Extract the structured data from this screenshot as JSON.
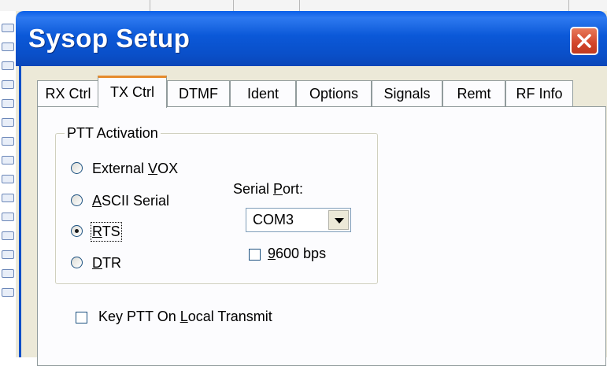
{
  "window": {
    "title": "Sysop Setup"
  },
  "tabs": [
    {
      "label": "RX Ctrl",
      "active": false
    },
    {
      "label": "TX Ctrl",
      "active": true
    },
    {
      "label": "DTMF",
      "active": false
    },
    {
      "label": "Ident",
      "active": false
    },
    {
      "label": "Options",
      "active": false
    },
    {
      "label": "Signals",
      "active": false
    },
    {
      "label": "Remt",
      "active": false
    },
    {
      "label": "RF Info",
      "active": false
    }
  ],
  "ptt": {
    "group_label": "PTT Activation",
    "options": [
      {
        "pre": "External ",
        "key": "V",
        "post": "OX",
        "checked": false
      },
      {
        "pre": "",
        "key": "A",
        "post": "SCII Serial",
        "checked": false
      },
      {
        "pre": "",
        "key": "R",
        "post": "TS",
        "checked": true
      },
      {
        "pre": "",
        "key": "D",
        "post": "TR",
        "checked": false
      }
    ],
    "serial_port": {
      "pre": "Serial ",
      "key": "P",
      "post": "ort:"
    },
    "serial_port_value": "COM3",
    "bps": {
      "pre": "",
      "key": "9",
      "post": "600 bps",
      "checked": false
    }
  },
  "key_ptt": {
    "pre": "Key PTT On ",
    "key": "L",
    "post": "ocal Transmit",
    "checked": false
  },
  "colors": {
    "titlebar": "#0a58d8",
    "close": "#d2452a",
    "active_tab": "#e68b2c"
  }
}
